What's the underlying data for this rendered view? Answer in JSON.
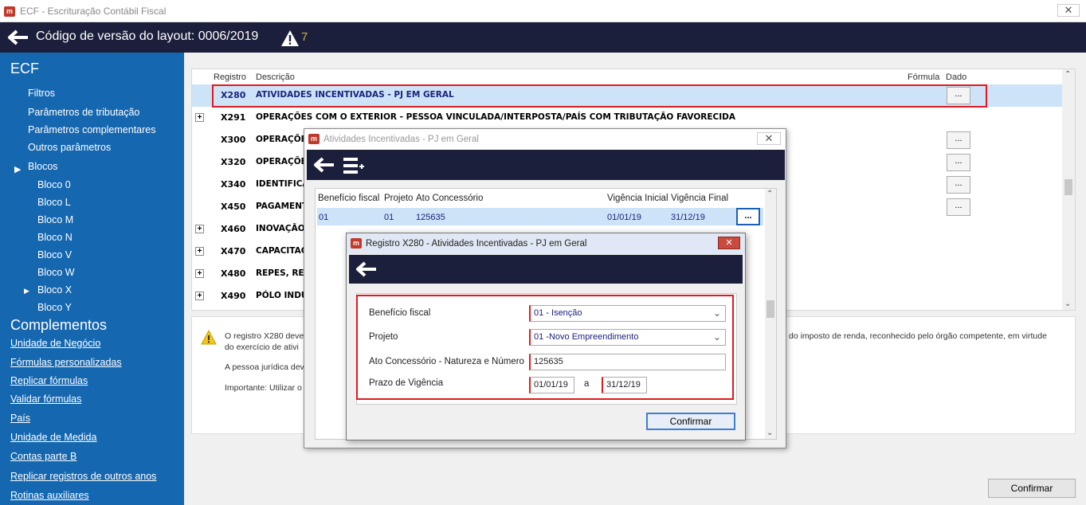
{
  "window": {
    "title": "ECF - Escrituração Contábil Fiscal",
    "close": "✕"
  },
  "header": {
    "version_text": "Código de versão do layout: 0006/2019",
    "warning_count": "7"
  },
  "sidebar": {
    "title": "ECF",
    "items": [
      "Filtros",
      "Parâmetros de tributação",
      "Parâmetros complementares",
      "Outros parâmetros",
      "Blocos"
    ],
    "blocks": [
      "Bloco 0",
      "Bloco L",
      "Bloco M",
      "Bloco N",
      "Bloco V",
      "Bloco W",
      "Bloco X",
      "Bloco Y"
    ],
    "complements_title": "Complementos",
    "complements": [
      "Unidade de Negócio",
      "Fórmulas personalizadas",
      "Replicar fórmulas",
      "Validar fórmulas",
      "País",
      "Unidade de Medida",
      "Contas parte B",
      "Replicar registros de outros anos",
      "Rotinas auxiliares"
    ]
  },
  "grid": {
    "headers": {
      "registro": "Registro",
      "descricao": "Descrição",
      "formula": "Fórmula",
      "dado": "Dado"
    },
    "rows": [
      {
        "code": "X280",
        "desc": "ATIVIDADES INCENTIVADAS - PJ EM GERAL",
        "expander": "",
        "dots": "..."
      },
      {
        "code": "X291",
        "desc": "OPERAÇÕES COM O EXTERIOR - PESSOA VINCULADA/INTERPOSTA/PAÍS COM TRIBUTAÇÃO FAVORECIDA",
        "expander": "+",
        "dots": ""
      },
      {
        "code": "X300",
        "desc": "OPERAÇÕES",
        "expander": "",
        "dots": "..."
      },
      {
        "code": "X320",
        "desc": "OPERAÇÕES",
        "expander": "",
        "dots": "..."
      },
      {
        "code": "X340",
        "desc": "IDENTIFICA",
        "expander": "",
        "dots": "..."
      },
      {
        "code": "X450",
        "desc": "PAGAMENT",
        "expander": "",
        "dots": "..."
      },
      {
        "code": "X460",
        "desc": "INOVAÇÃO",
        "expander": "+",
        "dots": ""
      },
      {
        "code": "X470",
        "desc": "CAPACITAÇ",
        "expander": "+",
        "dots": ""
      },
      {
        "code": "X480",
        "desc": "REPES, REC",
        "expander": "+",
        "dots": ""
      },
      {
        "code": "X490",
        "desc": "PÓLO INDUS",
        "expander": "+",
        "dots": ""
      }
    ]
  },
  "info": {
    "line1_left": "O registro X280 deve",
    "line1_right": "do imposto de renda, reconhecido pelo órgão competente, em virtude",
    "line2": "do exercício de ativi",
    "line3": "A pessoa jurídica dev",
    "line4": "Importante: Utilizar o"
  },
  "main_confirm": "Confirmar",
  "dialog1": {
    "title": "Atividades Incentivadas - PJ em Geral",
    "close": "✕",
    "headers": [
      "Benefício fiscal",
      "Projeto",
      "Ato Concessório",
      "Vigência Inicial",
      "Vigência Final"
    ],
    "row": {
      "beneficio": "01",
      "projeto": "01",
      "ato": "125635",
      "inicio": "01/01/19",
      "fim": "31/12/19",
      "dots": "..."
    }
  },
  "dialog2": {
    "title": "Registro X280 - Atividades Incentivadas - PJ em Geral",
    "close": "✕",
    "fields": {
      "beneficio_label": "Benefício fiscal",
      "beneficio_value": "01 - Isenção",
      "projeto_label": "Projeto",
      "projeto_value": "01 -Novo Empreendimento",
      "ato_label": "Ato Concessório - Natureza e Número",
      "ato_value": "125635",
      "prazo_label": "Prazo de Vigência",
      "prazo_inicio": "01/01/19",
      "prazo_sep": "a",
      "prazo_fim": "31/12/19"
    },
    "confirm": "Confirmar"
  },
  "colors": {
    "nav_bar": "#1b1f3b",
    "sidebar": "#1567b0",
    "selection": "#cde3f7",
    "highlight_red": "#e0191f"
  }
}
